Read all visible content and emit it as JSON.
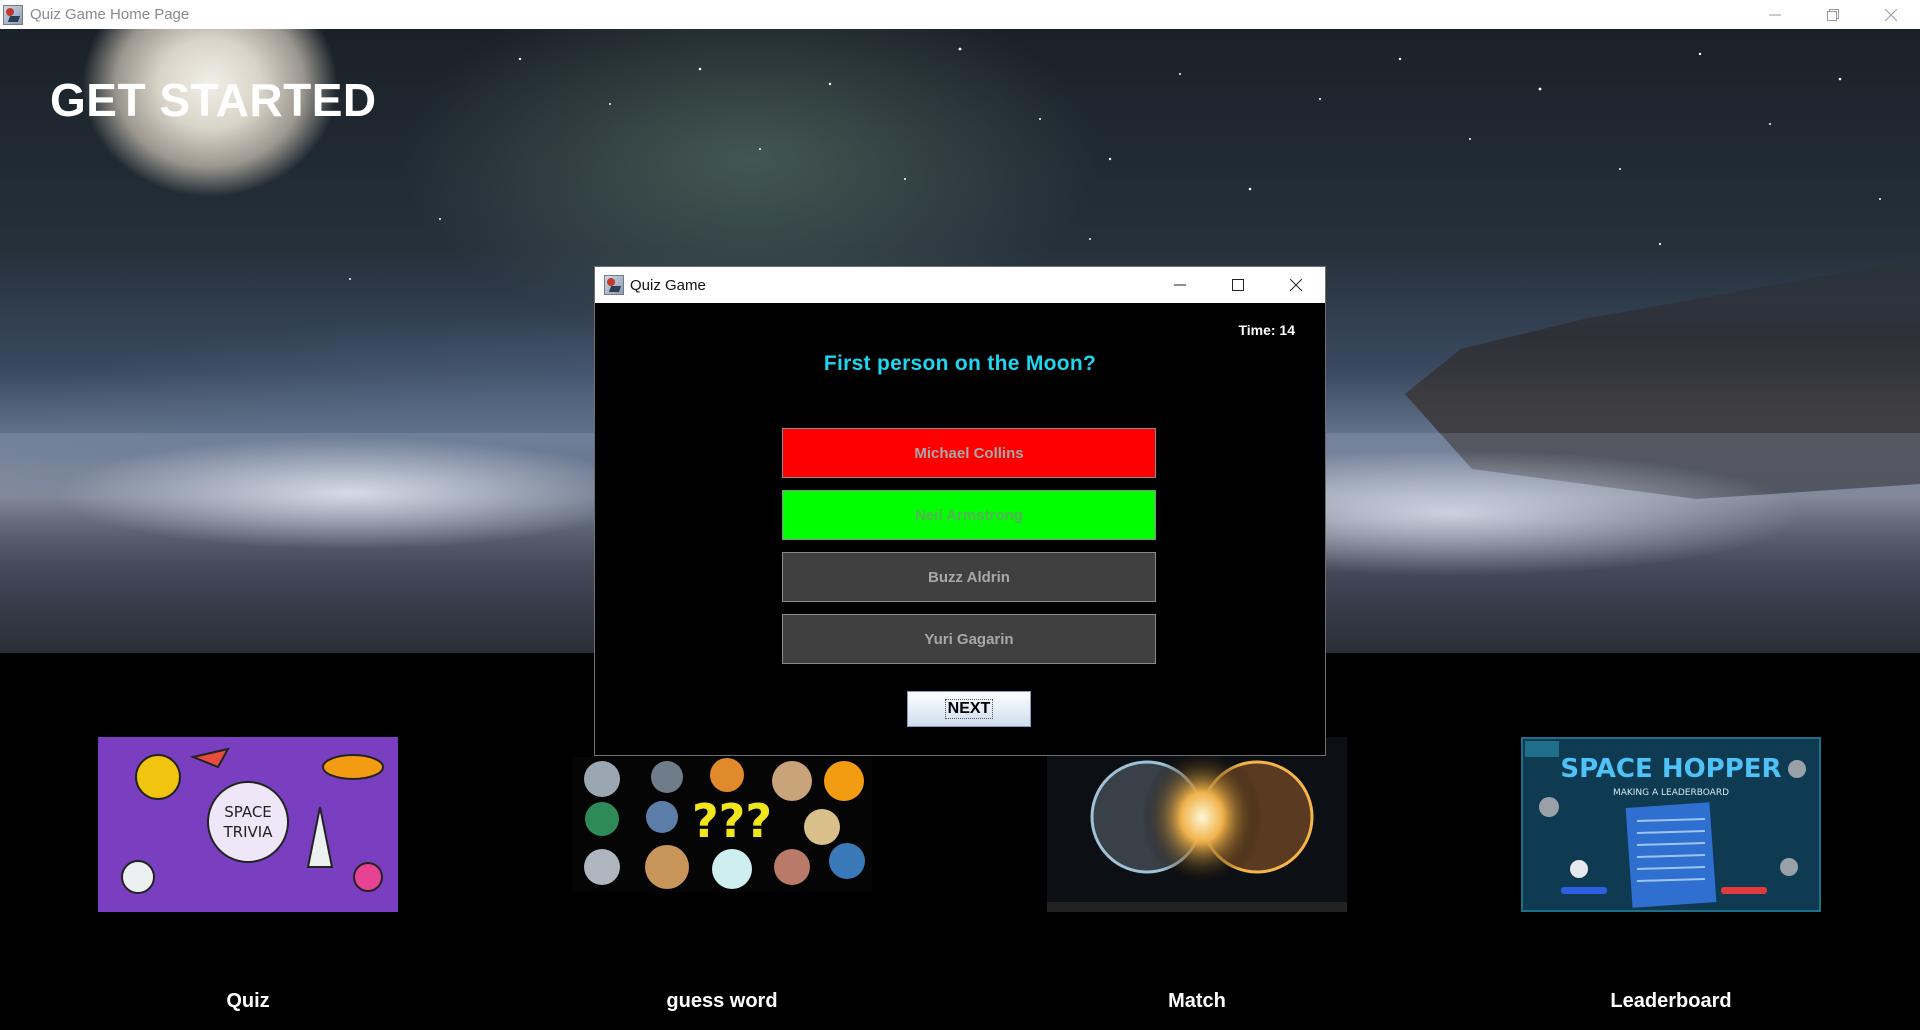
{
  "main_window": {
    "title": "Quiz Game Home Page"
  },
  "hero": {
    "heading": "GET STARTED"
  },
  "cards": [
    {
      "label": "Quiz",
      "image": "space-trivia-image",
      "image_text": [
        "SPACE",
        "TRIVIA"
      ]
    },
    {
      "label": "guess word",
      "image": "planets-question-image",
      "image_text": [
        "???"
      ]
    },
    {
      "label": "Match",
      "image": "colliding-planets-image"
    },
    {
      "label": "Leaderboard",
      "image": "space-hopper-image",
      "image_text": [
        "SPACE HOPPER",
        "MAKING A LEADERBOARD"
      ]
    }
  ],
  "dialog": {
    "title": "Quiz Game",
    "timer": "Time: 14",
    "question": "First person on the Moon?",
    "answers": [
      {
        "text": "Michael Collins",
        "color": "#ff0000"
      },
      {
        "text": "Neil Armstrong",
        "color": "#00ff00"
      },
      {
        "text": "Buzz Aldrin",
        "color": "#404040"
      },
      {
        "text": "Yuri Gagarin",
        "color": "#404040"
      }
    ],
    "next_label": "NEXT"
  },
  "colors": {
    "question_text": "#1ed6f0",
    "wrong_answer": "#ff0000",
    "correct_answer": "#00ff00",
    "neutral_answer": "#404040"
  }
}
